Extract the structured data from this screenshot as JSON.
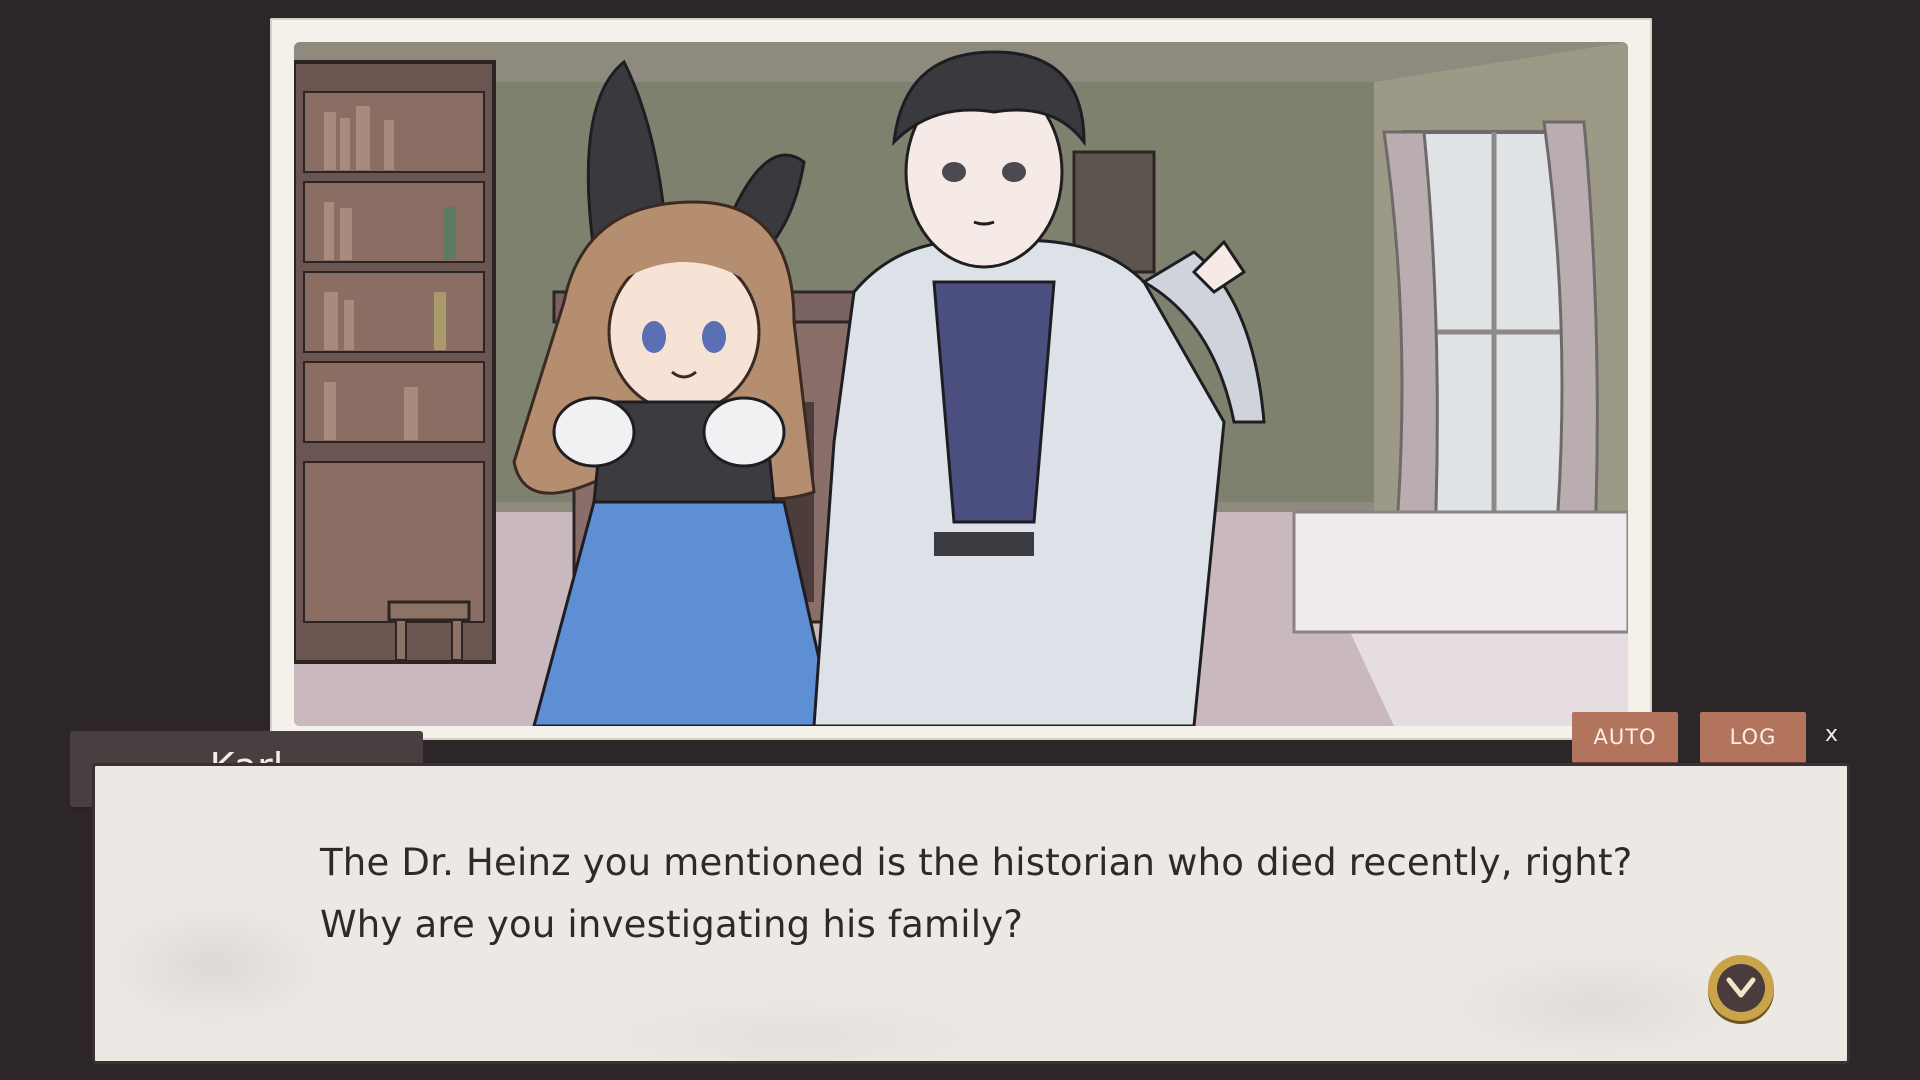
{
  "speaker": {
    "name": "Karl"
  },
  "dialogue": {
    "line1": "The Dr. Heinz you mentioned is the historian who died recently, right?",
    "line2": "Why are you investigating his family?"
  },
  "controls": {
    "auto_label": "AUTO",
    "log_label": "LOG",
    "close_label": "x",
    "advance_icon": "chevron-down-icon"
  },
  "colors": {
    "background": "#2d2629",
    "nameplate": "#4a3f40",
    "textbox": "#ece9e4",
    "button": "#b3745e",
    "advance_ring": "#c9a44b"
  }
}
